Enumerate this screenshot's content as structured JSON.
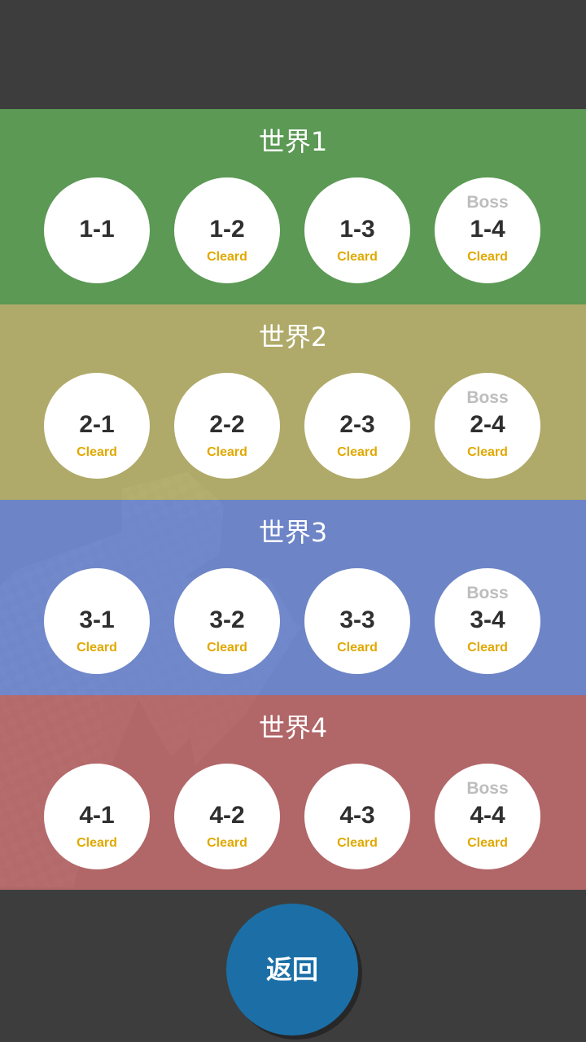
{
  "worlds": [
    {
      "title": "世界1",
      "color": "#5d9e55",
      "levels": [
        {
          "label": "1-1",
          "boss": "",
          "status": ""
        },
        {
          "label": "1-2",
          "boss": "",
          "status": "Cleard"
        },
        {
          "label": "1-3",
          "boss": "",
          "status": "Cleard"
        },
        {
          "label": "1-4",
          "boss": "Boss",
          "status": "Cleard"
        }
      ]
    },
    {
      "title": "世界2",
      "color": "#b5b06b",
      "levels": [
        {
          "label": "2-1",
          "boss": "",
          "status": "Cleard"
        },
        {
          "label": "2-2",
          "boss": "",
          "status": "Cleard"
        },
        {
          "label": "2-3",
          "boss": "",
          "status": "Cleard"
        },
        {
          "label": "2-4",
          "boss": "Boss",
          "status": "Cleard"
        }
      ]
    },
    {
      "title": "世界3",
      "color": "#7088cf",
      "levels": [
        {
          "label": "3-1",
          "boss": "",
          "status": "Cleard"
        },
        {
          "label": "3-2",
          "boss": "",
          "status": "Cleard"
        },
        {
          "label": "3-3",
          "boss": "",
          "status": "Cleard"
        },
        {
          "label": "3-4",
          "boss": "Boss",
          "status": "Cleard"
        }
      ]
    },
    {
      "title": "世界4",
      "color": "#b7686a",
      "levels": [
        {
          "label": "4-1",
          "boss": "",
          "status": "Cleard"
        },
        {
          "label": "4-2",
          "boss": "",
          "status": "Cleard"
        },
        {
          "label": "4-3",
          "boss": "",
          "status": "Cleard"
        },
        {
          "label": "4-4",
          "boss": "Boss",
          "status": "Cleard"
        }
      ]
    }
  ],
  "back_button": {
    "label": "返回",
    "color": "#1b6fa6"
  },
  "colors": {
    "background": "#3d3d3d",
    "cleared_text": "#e0a800",
    "boss_text": "#bdbdbd",
    "level_text": "#2f2f2f"
  }
}
